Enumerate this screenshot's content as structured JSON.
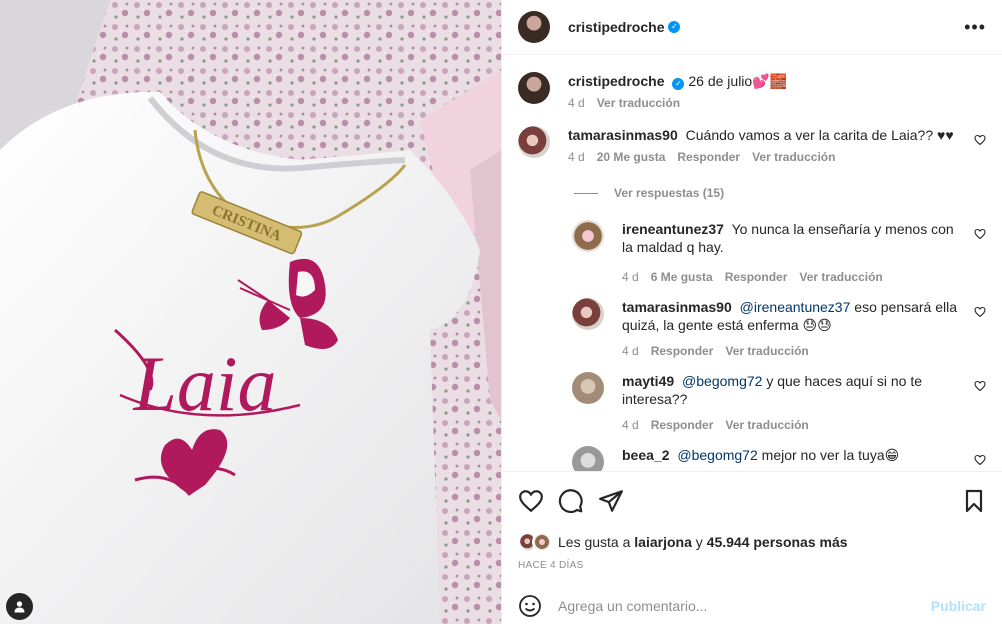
{
  "post": {
    "author": "cristipedroche",
    "caption": "26 de julio💕🧱",
    "caption_age": "4 d",
    "translate_label": "Ver traducción"
  },
  "comments": [
    {
      "user": "tamarasinmas90",
      "text": "Cuándo vamos a ver la carita de Laia?? ♥♥",
      "age": "4 d",
      "likes": "20 Me gusta",
      "reply_label": "Responder",
      "translate_label": "Ver traducción"
    }
  ],
  "replies_toggle": "Ver respuestas (15)",
  "replies": [
    {
      "user": "ireneantunez37",
      "mention": "",
      "text": "Yo nunca la enseñaría y menos con la maldad q hay.",
      "age": "4 d",
      "likes": "6 Me gusta",
      "reply_label": "Responder",
      "translate_label": "Ver traducción"
    },
    {
      "user": "tamarasinmas90",
      "mention": "@ireneantunez37",
      "text": "eso pensará ella quizá, la gente está enferma 😓😓",
      "age": "4 d",
      "reply_label": "Responder",
      "translate_label": "Ver traducción"
    },
    {
      "user": "mayti49",
      "mention": "@begomg72",
      "text": "y que haces aquí si no te interesa??",
      "age": "4 d",
      "reply_label": "Responder",
      "translate_label": "Ver traducción"
    },
    {
      "user": "beea_2",
      "mention": "@begomg72",
      "text": "mejor no ver la tuya😁"
    }
  ],
  "likes": {
    "prefix": "Les gusta a",
    "first_user": "laiarjona",
    "joiner": "y",
    "others": "45.944 personas más"
  },
  "timestamp": "HACE 4 DÍAS",
  "comment_box": {
    "placeholder": "Agrega un comentario...",
    "publish_label": "Publicar"
  },
  "image": {
    "name_tag": "CRISTINA",
    "print_text": "Laia"
  },
  "colors": {
    "accent": "#0095f6",
    "magenta": "#b0195c",
    "publish_disabled": "#b2dffc"
  }
}
